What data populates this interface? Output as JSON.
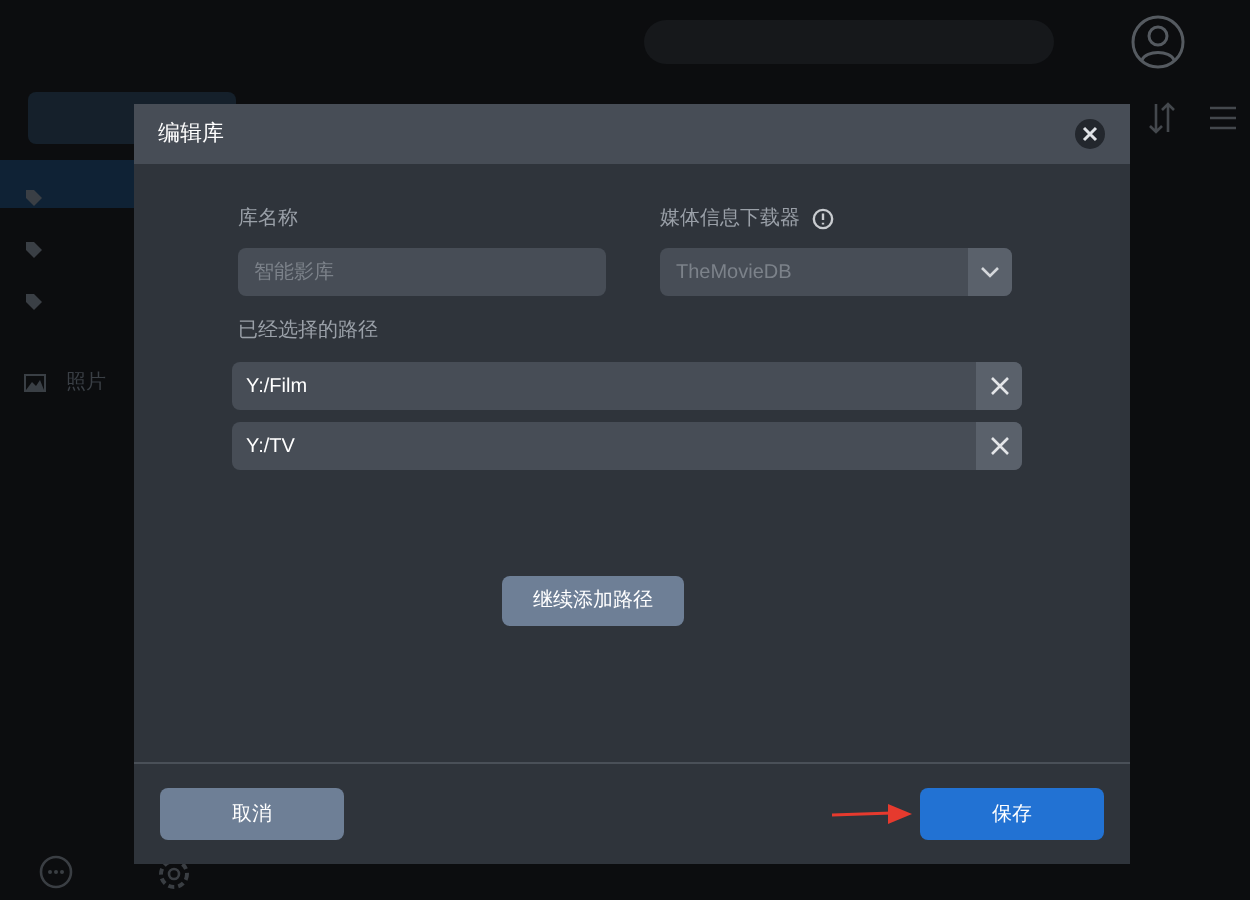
{
  "background": {
    "sidebar": [
      {
        "kind": "tag"
      },
      {
        "kind": "tag"
      },
      {
        "kind": "tag"
      },
      {
        "kind": "photo",
        "label": "照片"
      }
    ]
  },
  "dialog": {
    "title": "编辑库",
    "name_field": {
      "label": "库名称",
      "placeholder": "智能影库"
    },
    "scraper": {
      "label": "媒体信息下载器",
      "value": "TheMovieDB"
    },
    "paths_label": "已经选择的路径",
    "paths": [
      "Y:/Film",
      "Y:/TV"
    ],
    "add_button": "继续添加路径",
    "cancel_button": "取消",
    "save_button": "保存"
  }
}
